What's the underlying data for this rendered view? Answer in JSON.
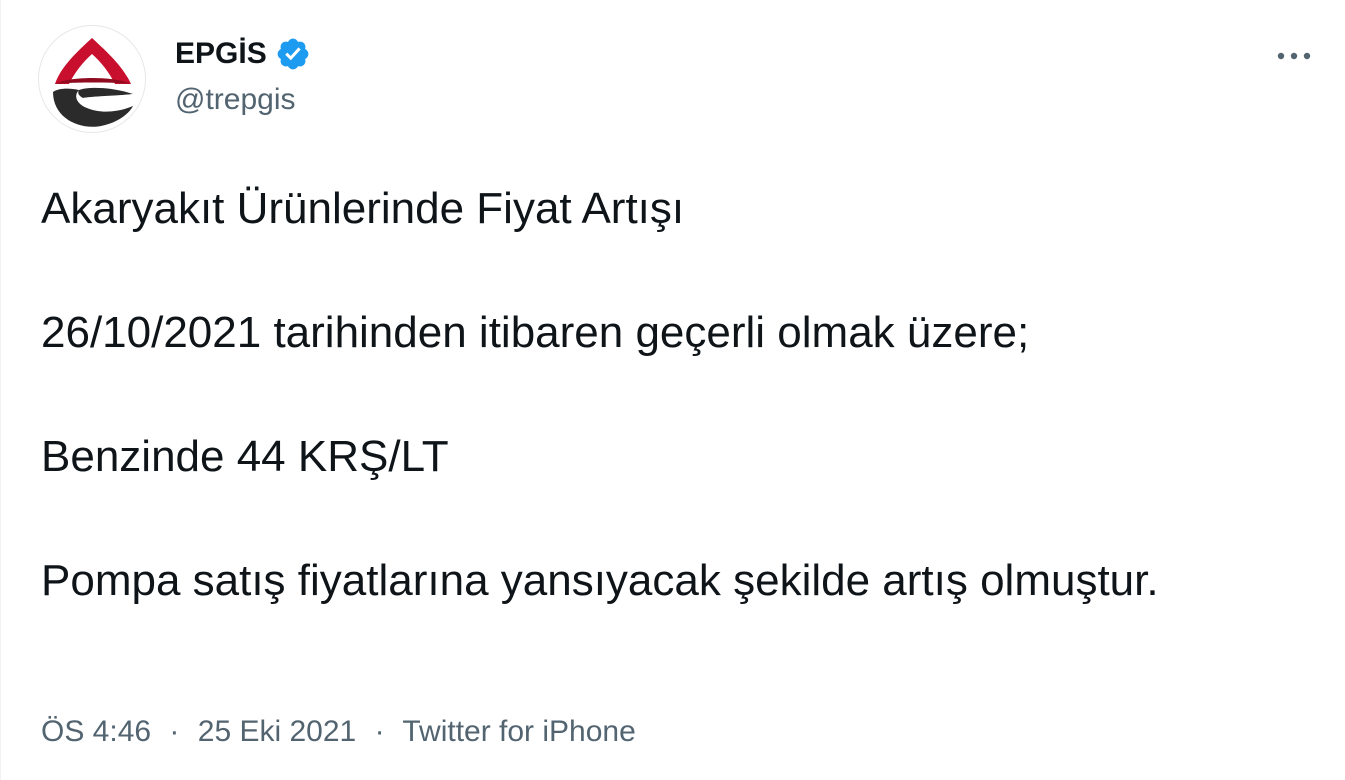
{
  "author": {
    "display_name": "EPGİS",
    "handle": "@trepgis",
    "verified": true,
    "verified_color": "#1d9bf0",
    "avatar_icon": "epgis-logo-icon"
  },
  "more_icon": "more-horizontal-icon",
  "tweet": {
    "lines": [
      "Akaryakıt Ürünlerinde Fiyat Artışı",
      "26/10/2021 tarihinden itibaren geçerli olmak üzere;",
      "Benzinde 44 KRŞ/LT",
      "Pompa satış fiyatlarına yansıyacak şekilde artış olmuştur."
    ]
  },
  "meta": {
    "time": "ÖS 4:46",
    "separator": "·",
    "date": "25 Eki 2021",
    "source": "Twitter for iPhone"
  },
  "colors": {
    "text": "#0f1419",
    "secondary": "#536471",
    "logo_red": "#c8102e",
    "logo_dark": "#2b2b2b"
  }
}
